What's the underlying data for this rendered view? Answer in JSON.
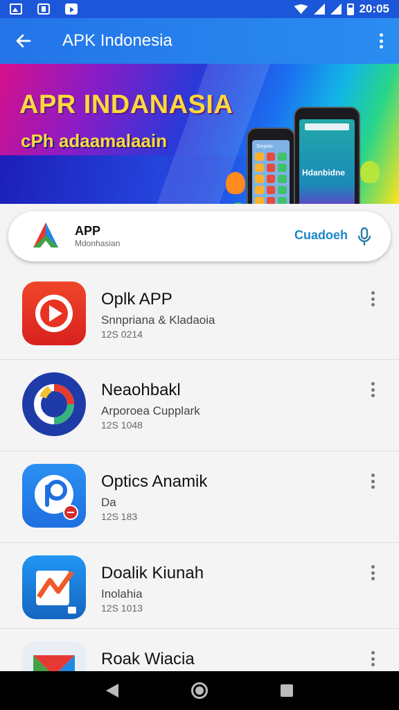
{
  "status_bar": {
    "time": "20:05"
  },
  "app_bar": {
    "title": "APK Indonesia"
  },
  "banner": {
    "headline": "APR INDANASIA",
    "subline": "cPh adaamalaain",
    "phone_small_text": "Smpiao",
    "phone_big_text": "Hdanbidne"
  },
  "search_card": {
    "app_label": "APP",
    "sub_label": "Mdonhasian",
    "button_label": "Cuadoeh"
  },
  "apps": [
    {
      "name": "Oplk APP",
      "description": "Snnpriana & Kladaoia",
      "size": "12S 0214"
    },
    {
      "name": "Neaohbakl",
      "description": "Arporoea Cupplark",
      "size": "12S 1048"
    },
    {
      "name": "Optics Anamik",
      "description": "Da",
      "size": "12S 183"
    },
    {
      "name": "Doalik Kiunah",
      "description": "Inolahia",
      "size": "12S 1013"
    },
    {
      "name": "Roak Wiacia",
      "description": "",
      "size": ""
    }
  ],
  "icons": {
    "back": "arrow-left-icon",
    "menu": "more-vert-icon",
    "mic": "mic-icon"
  },
  "colors": {
    "status_bar": "#1c56d9",
    "app_bar": "#2a80ee",
    "accent": "#1c86c8"
  }
}
